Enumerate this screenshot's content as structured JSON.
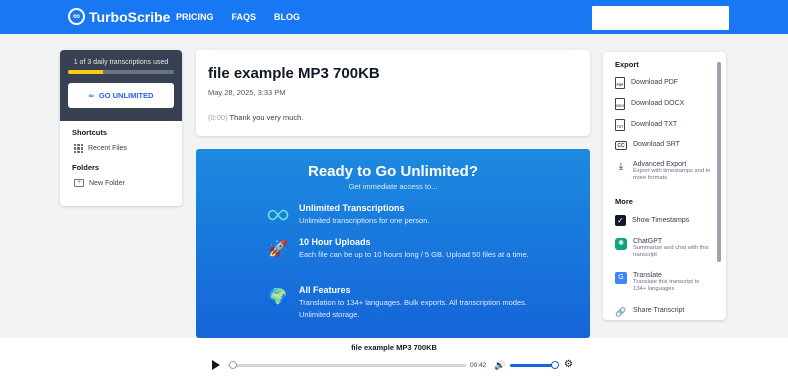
{
  "header": {
    "brand": "TurboScribe",
    "nav": [
      "PRICING",
      "FAQS",
      "BLOG"
    ]
  },
  "left_panel": {
    "usage_text": "1 of 3 daily transcriptions used",
    "usage_fraction": 0.33,
    "go_unlimited": "GO UNLIMITED",
    "shortcuts_title": "Shortcuts",
    "recent_files": "Recent Files",
    "folders_title": "Folders",
    "new_folder": "New Folder"
  },
  "transcript": {
    "title": "file example MP3 700KB",
    "date": "May 28, 2025, 3:33 PM",
    "timestamp": "(0:00)",
    "text": "Thank you very much."
  },
  "promo": {
    "title": "Ready to Go Unlimited?",
    "subtitle": "Get immediate access to...",
    "features": [
      {
        "icon": "infinity-icon",
        "title": "Unlimited Transcriptions",
        "text": "Unlimited transcriptions for one person."
      },
      {
        "icon": "rocket-icon",
        "title": "10 Hour Uploads",
        "text": "Each file can be up to 10 hours long / 5 GB. Upload 50 files at a time."
      },
      {
        "icon": "globe-icon",
        "title": "All Features",
        "text": "Translation to 134+ languages. Bulk exports. All transcription modes. Unlimited storage."
      }
    ]
  },
  "right_panel": {
    "export_title": "Export",
    "download_pdf": "Download PDF",
    "download_docx": "Download DOCX",
    "download_txt": "Download TXT",
    "download_srt": "Download SRT",
    "advanced_export": "Advanced Export",
    "advanced_export_desc": "Export with timestamps and in more formats",
    "more_title": "More",
    "show_timestamps": "Show Timestamps",
    "chatgpt": "ChatGPT",
    "chatgpt_desc": "Summarize and chat with this transcript",
    "translate": "Translate",
    "translate_desc": "Translate this transcript to 134+ languages",
    "share": "Share Transcript",
    "pdf_tag": "PDF",
    "docx_tag": "DOCX",
    "txt_tag": "TXT",
    "srt_tag": "CC"
  },
  "player": {
    "title": "file example MP3 700KB",
    "time": "00:42",
    "progress_fraction": 0.0,
    "volume_fraction": 0.9
  },
  "colors": {
    "brand_blue": "#1877f2",
    "promo_top": "#1d8ae0",
    "promo_bottom": "#1565d8",
    "usage_bar": "#facc15",
    "usage_bg": "#374151"
  }
}
